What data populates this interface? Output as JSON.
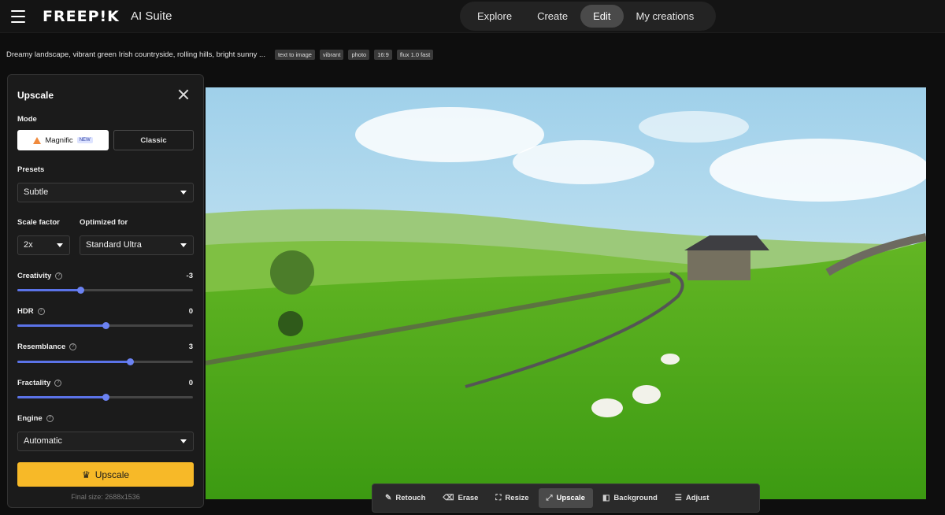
{
  "app": {
    "logo": "FREEP!K",
    "suite": "AI Suite"
  },
  "nav": [
    {
      "label": "Explore",
      "active": false
    },
    {
      "label": "Create",
      "active": false
    },
    {
      "label": "Edit",
      "active": true
    },
    {
      "label": "My creations",
      "active": false
    }
  ],
  "prompt": {
    "text": "Dreamy landscape, vibrant green Irish countryside, rolling hills, bright sunny ...",
    "tags": [
      "text to image",
      "vibrant",
      "photo",
      "16:9",
      "flux 1.0 fast"
    ]
  },
  "panel": {
    "title": "Upscale",
    "mode_label": "Mode",
    "mode_magnific": "Magnific",
    "mode_new_badge": "NEW",
    "mode_classic": "Classic",
    "presets_label": "Presets",
    "presets_value": "Subtle",
    "scale_label": "Scale factor",
    "scale_value": "2x",
    "optimized_label": "Optimized for",
    "optimized_value": "Standard Ultra",
    "sliders": [
      {
        "label": "Creativity",
        "value": "-3",
        "fraction": 0.36
      },
      {
        "label": "HDR",
        "value": "0",
        "fraction": 0.5
      },
      {
        "label": "Resemblance",
        "value": "3",
        "fraction": 0.64
      },
      {
        "label": "Fractality",
        "value": "0",
        "fraction": 0.5
      }
    ],
    "engine_label": "Engine",
    "engine_value": "Automatic",
    "upscale_button": "Upscale",
    "final_size": "Final size: 2688x1536"
  },
  "toolbar": [
    {
      "label": "Retouch",
      "icon": "brush-icon",
      "active": false
    },
    {
      "label": "Erase",
      "icon": "eraser-icon",
      "active": false
    },
    {
      "label": "Resize",
      "icon": "crop-icon",
      "active": false
    },
    {
      "label": "Upscale",
      "icon": "upscale-icon",
      "active": true
    },
    {
      "label": "Background",
      "icon": "background-icon",
      "active": false
    },
    {
      "label": "Adjust",
      "icon": "sliders-icon",
      "active": false
    }
  ],
  "colors": {
    "accent": "#f7b928",
    "slider": "#5b73e8",
    "background": "#0e0e0e"
  }
}
